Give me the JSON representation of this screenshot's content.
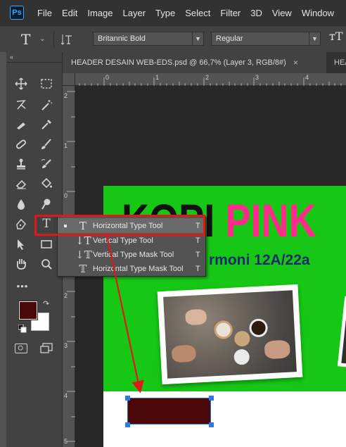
{
  "app": {
    "logo_text": "Ps"
  },
  "menu": {
    "items": [
      "File",
      "Edit",
      "Image",
      "Layer",
      "Type",
      "Select",
      "Filter",
      "3D",
      "View",
      "Window"
    ]
  },
  "options_bar": {
    "tool_icon": "type-icon",
    "font_family": "Britannic Bold",
    "font_style": "Regular"
  },
  "tabs": {
    "active": {
      "label": "HEADER DESAIN WEB-EDS.psd @ 66,7% (Layer 3, RGB/8#)",
      "close": "×"
    },
    "next": {
      "label": "HEA"
    }
  },
  "rulers": {
    "horizontal": [
      "0",
      "1",
      "2",
      "3",
      "4"
    ],
    "vertical": [
      "2",
      "1",
      "0",
      "1",
      "2",
      "3",
      "4",
      "5"
    ]
  },
  "toolbar": {
    "collapse": "‹‹",
    "more": "•••",
    "foreground_color": "#4a0a0a",
    "background_color": "#ffffff"
  },
  "flyout": {
    "items": [
      {
        "label": "Horizontal Type Tool",
        "shortcut": "T",
        "icon": "horizontal-type-icon",
        "selected": true
      },
      {
        "label": "Vertical Type Tool",
        "shortcut": "T",
        "icon": "vertical-type-icon",
        "selected": false
      },
      {
        "label": "Vertical Type Mask Tool",
        "shortcut": "T",
        "icon": "vertical-type-mask-icon",
        "selected": false
      },
      {
        "label": "Horizontal Type Mask Tool",
        "shortcut": "T",
        "icon": "horizontal-type-mask-icon",
        "selected": false
      }
    ]
  },
  "document": {
    "title_part1": "KOPI",
    "title_part2": "PINK",
    "subtitle": "rmoni 12A/22a",
    "colors": {
      "green": "#16c716",
      "pink": "#ff2a8c",
      "shape": "#4a0808"
    }
  },
  "annotation": {
    "highlight_color": "#e01818"
  }
}
